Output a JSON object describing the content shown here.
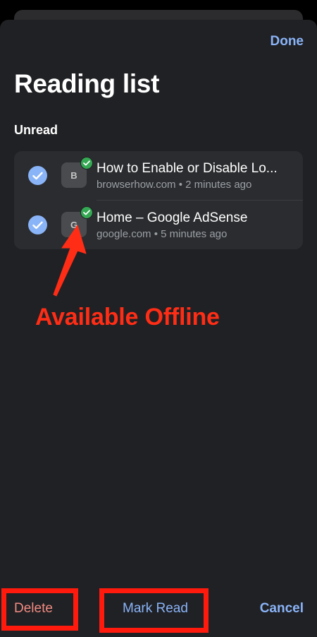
{
  "header": {
    "done_label": "Done",
    "title": "Reading list"
  },
  "section": {
    "label": "Unread"
  },
  "items": [
    {
      "initial": "B",
      "title": "How to Enable or Disable Lo...",
      "meta": "browserhow.com • 2 minutes ago",
      "selected": true,
      "available_offline": true
    },
    {
      "initial": "G",
      "title": "Home – Google AdSense",
      "meta": "google.com • 5 minutes ago",
      "selected": true,
      "available_offline": true
    }
  ],
  "annotation": {
    "text": "Available Offline",
    "color": "#ff2d16"
  },
  "toolbar": {
    "delete_label": "Delete",
    "mark_read_label": "Mark Read",
    "cancel_label": "Cancel"
  },
  "colors": {
    "accent": "#8ab4f8",
    "destructive": "#f28b82",
    "offline_badge": "#34a853",
    "sheet_bg": "#202124"
  }
}
